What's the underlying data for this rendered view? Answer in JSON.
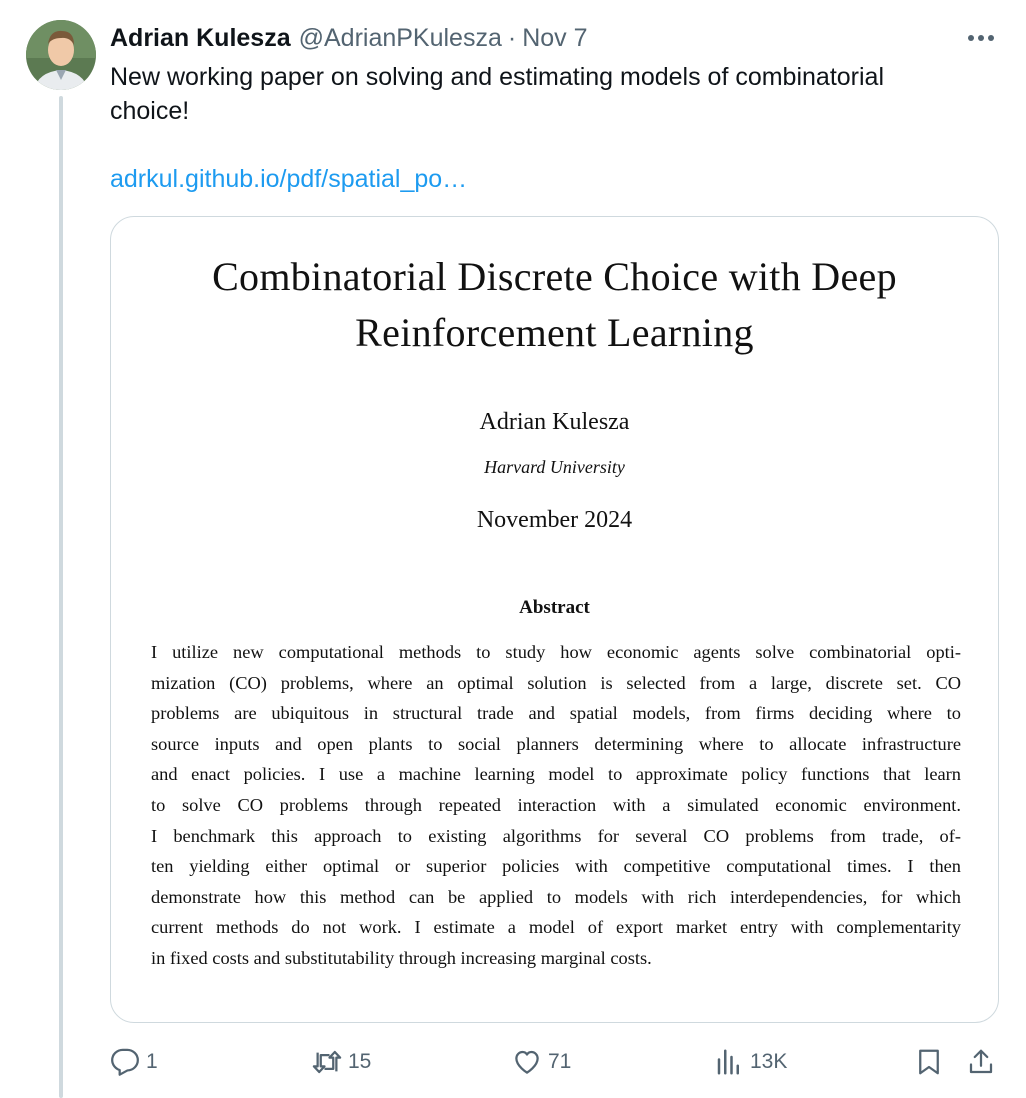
{
  "tweet": {
    "author_name": "Adrian Kulesza",
    "handle": "@AdrianPKulesza",
    "separator": "·",
    "date": "Nov 7",
    "text": "New working paper on solving and estimating models of combinatorial choice!",
    "link": "adrkul.github.io/pdf/spatial_po…"
  },
  "paper": {
    "title_line1": "Combinatorial Discrete Choice with Deep",
    "title_line2": "Reinforcement Learning",
    "author": "Adrian Kulesza",
    "affiliation": "Harvard University",
    "date": "November 2024",
    "abstract_heading": "Abstract",
    "abstract_lines": [
      "I utilize new computational methods to study how economic agents solve combinatorial opti-",
      "mization (CO) problems, where an optimal solution is selected from a large, discrete set. CO",
      "problems are ubiquitous in structural trade and spatial models, from firms deciding where to",
      "source inputs and open plants to social planners determining where to allocate infrastructure",
      "and enact policies. I use a machine learning model to approximate policy functions that learn",
      "to solve CO problems through repeated interaction with a simulated economic environment.",
      "I benchmark this approach to existing algorithms for several CO problems from trade, of-",
      "ten yielding either optimal or superior policies with competitive computational times. I then",
      "demonstrate how this method can be applied to models with rich interdependencies, for which",
      "current methods do not work. I estimate a model of export market entry with complementarity",
      "in fixed costs and substitutability through increasing marginal costs."
    ]
  },
  "actions": {
    "replies": "1",
    "reposts": "15",
    "likes": "71",
    "views": "13K"
  },
  "icons": {
    "more": "more-icon",
    "reply": "reply-icon",
    "repost": "repost-icon",
    "like": "heart-icon",
    "views": "views-icon",
    "bookmark": "bookmark-icon",
    "share": "share-icon"
  },
  "colors": {
    "link": "#1d9bf0",
    "muted": "#536471",
    "text": "#0f1419",
    "border": "#cfd9de"
  }
}
